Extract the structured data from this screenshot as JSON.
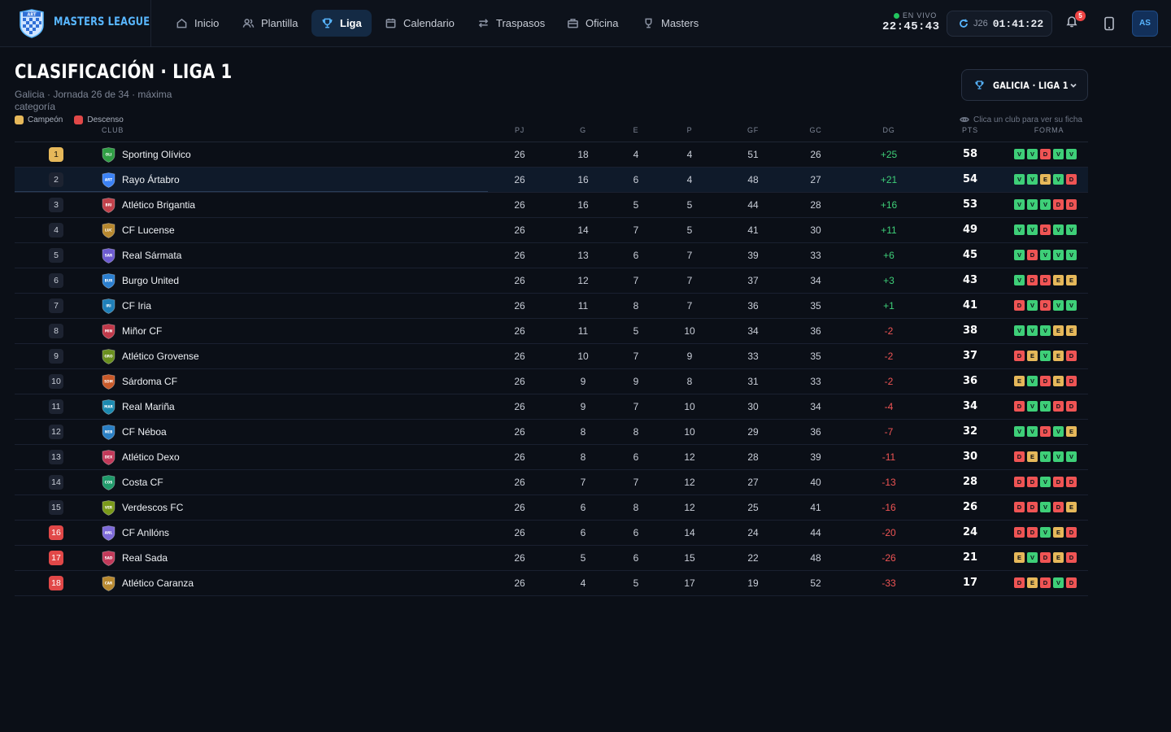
{
  "app": {
    "name": "MASTERS LEAGUE",
    "logo_text": "ART"
  },
  "nav": [
    {
      "label": "Inicio",
      "icon": "home-icon",
      "active": false
    },
    {
      "label": "Plantilla",
      "icon": "users-icon",
      "active": false
    },
    {
      "label": "Liga",
      "icon": "trophy-icon",
      "active": true
    },
    {
      "label": "Calendario",
      "icon": "calendar-icon",
      "active": false
    },
    {
      "label": "Traspasos",
      "icon": "transfer-icon",
      "active": false
    },
    {
      "label": "Oficina",
      "icon": "briefcase-icon",
      "active": false
    },
    {
      "label": "Masters",
      "icon": "cup-icon",
      "active": false
    }
  ],
  "clock": {
    "live_label": "EN VIVO",
    "time": "22:45:43"
  },
  "timer": {
    "round": "J26",
    "time": "01:41:22"
  },
  "notifications": {
    "count": "5"
  },
  "user": {
    "initials": "AS"
  },
  "page": {
    "title": "CLASIFICACIÓN · LIGA 1",
    "subtitle": "Galicia · Jornada 26 de 34 · máxima categoría",
    "legend": [
      {
        "label": "Campeón",
        "color": "#e6b85a"
      },
      {
        "label": "Descenso",
        "color": "#e14848"
      }
    ],
    "league_select": "GALICIA · LIGA 1",
    "hint": "Clica un club para ver su ficha"
  },
  "colors": {
    "accent": "#58b6ff",
    "win": "#3ecf78",
    "draw": "#e6b85a",
    "loss": "#ef5454",
    "champion": "#e6b85a",
    "relegation": "#e14848"
  },
  "table": {
    "headers": {
      "club": "CLUB",
      "pj": "PJ",
      "g": "G",
      "e": "E",
      "p": "P",
      "gf": "GF",
      "gc": "GC",
      "dg": "DG",
      "pts": "PTS",
      "forma": "FORMA"
    },
    "rows": [
      {
        "pos": "1",
        "zone": "champ",
        "club": "Sporting Olívico",
        "abbr": "OLI",
        "crest": "#2f9e44",
        "pj": "26",
        "g": "18",
        "e": "4",
        "p": "4",
        "gf": "51",
        "gc": "26",
        "dg": "+25",
        "pts": "58",
        "form": [
          "V",
          "V",
          "D",
          "V",
          "V"
        ]
      },
      {
        "pos": "2",
        "zone": "",
        "club": "Rayo Ártabro",
        "abbr": "ART",
        "crest": "#3b82f6",
        "pj": "26",
        "g": "16",
        "e": "6",
        "p": "4",
        "gf": "48",
        "gc": "27",
        "dg": "+21",
        "pts": "54",
        "form": [
          "V",
          "V",
          "E",
          "V",
          "D"
        ],
        "selected": true
      },
      {
        "pos": "3",
        "zone": "",
        "club": "Atlético Brigantia",
        "abbr": "BRI",
        "crest": "#c2414b",
        "pj": "26",
        "g": "16",
        "e": "5",
        "p": "5",
        "gf": "44",
        "gc": "28",
        "dg": "+16",
        "pts": "53",
        "form": [
          "V",
          "V",
          "V",
          "D",
          "D"
        ]
      },
      {
        "pos": "4",
        "zone": "",
        "club": "CF Lucense",
        "abbr": "LUC",
        "crest": "#b7882f",
        "pj": "26",
        "g": "14",
        "e": "7",
        "p": "5",
        "gf": "41",
        "gc": "30",
        "dg": "+11",
        "pts": "49",
        "form": [
          "V",
          "V",
          "D",
          "V",
          "V"
        ]
      },
      {
        "pos": "5",
        "zone": "",
        "club": "Real Sármata",
        "abbr": "SAR",
        "crest": "#6d5bd0",
        "pj": "26",
        "g": "13",
        "e": "6",
        "p": "7",
        "gf": "39",
        "gc": "33",
        "dg": "+6",
        "pts": "45",
        "form": [
          "V",
          "D",
          "V",
          "V",
          "V"
        ]
      },
      {
        "pos": "6",
        "zone": "",
        "club": "Burgo United",
        "abbr": "BUR",
        "crest": "#2b7fd0",
        "pj": "26",
        "g": "12",
        "e": "7",
        "p": "7",
        "gf": "37",
        "gc": "34",
        "dg": "+3",
        "pts": "43",
        "form": [
          "V",
          "D",
          "D",
          "E",
          "E"
        ]
      },
      {
        "pos": "7",
        "zone": "",
        "club": "CF Iria",
        "abbr": "IRI",
        "crest": "#1f7fb8",
        "pj": "26",
        "g": "11",
        "e": "8",
        "p": "7",
        "gf": "36",
        "gc": "35",
        "dg": "+1",
        "pts": "41",
        "form": [
          "D",
          "V",
          "D",
          "V",
          "V"
        ]
      },
      {
        "pos": "8",
        "zone": "",
        "club": "Miñor CF",
        "abbr": "MIN",
        "crest": "#c0394a",
        "pj": "26",
        "g": "11",
        "e": "5",
        "p": "10",
        "gf": "34",
        "gc": "36",
        "dg": "-2",
        "pts": "38",
        "form": [
          "V",
          "V",
          "V",
          "E",
          "E"
        ]
      },
      {
        "pos": "9",
        "zone": "",
        "club": "Atlético Grovense",
        "abbr": "GRO",
        "crest": "#6a8f1f",
        "pj": "26",
        "g": "10",
        "e": "7",
        "p": "9",
        "gf": "33",
        "gc": "35",
        "dg": "-2",
        "pts": "37",
        "form": [
          "D",
          "E",
          "V",
          "E",
          "D"
        ]
      },
      {
        "pos": "10",
        "zone": "",
        "club": "Sárdoma CF",
        "abbr": "SDM",
        "crest": "#c85a2a",
        "pj": "26",
        "g": "9",
        "e": "9",
        "p": "8",
        "gf": "31",
        "gc": "33",
        "dg": "-2",
        "pts": "36",
        "form": [
          "E",
          "V",
          "D",
          "E",
          "D"
        ]
      },
      {
        "pos": "11",
        "zone": "",
        "club": "Real Mariña",
        "abbr": "MAR",
        "crest": "#1c8ab0",
        "pj": "26",
        "g": "9",
        "e": "7",
        "p": "10",
        "gf": "30",
        "gc": "34",
        "dg": "-4",
        "pts": "34",
        "form": [
          "D",
          "V",
          "V",
          "D",
          "D"
        ]
      },
      {
        "pos": "12",
        "zone": "",
        "club": "CF Néboa",
        "abbr": "NEB",
        "crest": "#2a7fc4",
        "pj": "26",
        "g": "8",
        "e": "8",
        "p": "10",
        "gf": "29",
        "gc": "36",
        "dg": "-7",
        "pts": "32",
        "form": [
          "V",
          "V",
          "D",
          "V",
          "E"
        ]
      },
      {
        "pos": "13",
        "zone": "",
        "club": "Atlético Dexo",
        "abbr": "DEX",
        "crest": "#c23a5a",
        "pj": "26",
        "g": "8",
        "e": "6",
        "p": "12",
        "gf": "28",
        "gc": "39",
        "dg": "-11",
        "pts": "30",
        "form": [
          "D",
          "E",
          "V",
          "V",
          "V"
        ]
      },
      {
        "pos": "14",
        "zone": "",
        "club": "Costa CF",
        "abbr": "COS",
        "crest": "#1f9a6a",
        "pj": "26",
        "g": "7",
        "e": "7",
        "p": "12",
        "gf": "27",
        "gc": "40",
        "dg": "-13",
        "pts": "28",
        "form": [
          "D",
          "D",
          "V",
          "D",
          "D"
        ]
      },
      {
        "pos": "15",
        "zone": "",
        "club": "Verdescos FC",
        "abbr": "VER",
        "crest": "#7a9a1a",
        "pj": "26",
        "g": "6",
        "e": "8",
        "p": "12",
        "gf": "25",
        "gc": "41",
        "dg": "-16",
        "pts": "26",
        "form": [
          "D",
          "D",
          "V",
          "D",
          "E"
        ]
      },
      {
        "pos": "16",
        "zone": "releg",
        "club": "CF Anllóns",
        "abbr": "ANL",
        "crest": "#7d6ad8",
        "pj": "26",
        "g": "6",
        "e": "6",
        "p": "14",
        "gf": "24",
        "gc": "44",
        "dg": "-20",
        "pts": "24",
        "form": [
          "D",
          "D",
          "V",
          "E",
          "D"
        ]
      },
      {
        "pos": "17",
        "zone": "releg",
        "club": "Real Sada",
        "abbr": "SAD",
        "crest": "#c23a5a",
        "pj": "26",
        "g": "5",
        "e": "6",
        "p": "15",
        "gf": "22",
        "gc": "48",
        "dg": "-26",
        "pts": "21",
        "form": [
          "E",
          "V",
          "D",
          "E",
          "D"
        ]
      },
      {
        "pos": "18",
        "zone": "releg",
        "club": "Atlético Caranza",
        "abbr": "CAR",
        "crest": "#b7882f",
        "pj": "26",
        "g": "4",
        "e": "5",
        "p": "17",
        "gf": "19",
        "gc": "52",
        "dg": "-33",
        "pts": "17",
        "form": [
          "D",
          "E",
          "D",
          "V",
          "D"
        ]
      }
    ]
  }
}
